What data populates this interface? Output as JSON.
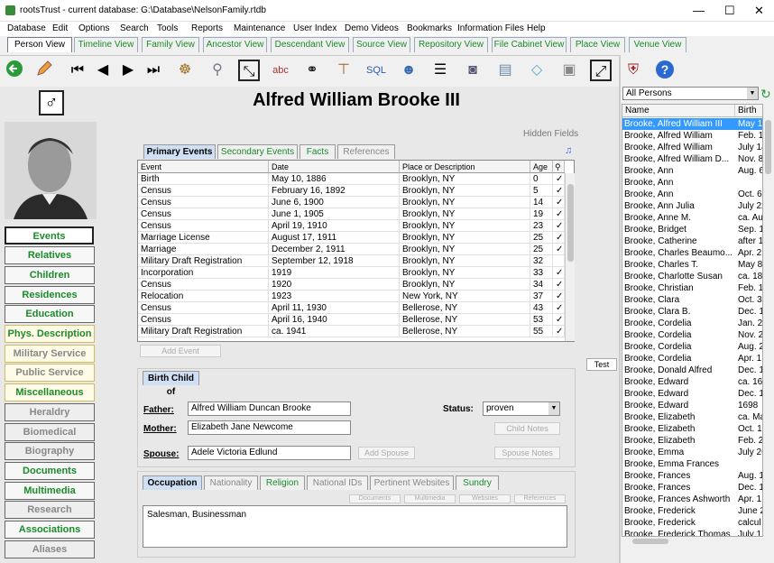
{
  "window": {
    "title": "rootsTrust - current database: G:\\Database\\NelsonFamily.rtdb"
  },
  "menu": [
    "Database",
    "Edit",
    "Options",
    "Search",
    "Tools",
    "Reports",
    "Maintenance",
    "User Index",
    "Demo Videos",
    "Bookmarks",
    "Information Files",
    "Help"
  ],
  "view_tabs": [
    "Person View",
    "Timeline View",
    "Family View",
    "Ancestor View",
    "Descendant View",
    "Source View",
    "Repository View",
    "File Cabinet View",
    "Place View",
    "Venue View"
  ],
  "person": {
    "name": "Alfred William Brooke III",
    "hidden_fields": "Hidden Fields"
  },
  "sidebar": [
    "Events",
    "Relatives",
    "Children",
    "Residences",
    "Education",
    "Phys. Description",
    "Military Service",
    "Public Service",
    "Miscellaneous",
    "Heraldry",
    "Biomedical",
    "Biography",
    "Documents",
    "Multimedia",
    "Research",
    "Associations",
    "Aliases"
  ],
  "event_tabs": [
    "Primary Events",
    "Secondary Events",
    "Facts",
    "References"
  ],
  "event_headers": [
    "Event",
    "Date",
    "Place or Description",
    "Age"
  ],
  "events": [
    {
      "event": "Birth",
      "date": "May 10, 1886",
      "place": "Brooklyn, NY",
      "age": "0",
      "chk": "✓"
    },
    {
      "event": "Census",
      "date": "February 16, 1892",
      "place": "Brooklyn, NY",
      "age": "5",
      "chk": "✓"
    },
    {
      "event": "Census",
      "date": "June 6, 1900",
      "place": "Brooklyn, NY",
      "age": "14",
      "chk": "✓"
    },
    {
      "event": "Census",
      "date": "June 1, 1905",
      "place": "Brooklyn, NY",
      "age": "19",
      "chk": "✓"
    },
    {
      "event": "Census",
      "date": "April 19, 1910",
      "place": "Brooklyn, NY",
      "age": "23",
      "chk": "✓"
    },
    {
      "event": "Marriage License",
      "date": "August 17, 1911",
      "place": "Brooklyn, NY",
      "age": "25",
      "chk": "✓"
    },
    {
      "event": "Marriage",
      "date": "December 2, 1911",
      "place": "Brooklyn, NY",
      "age": "25",
      "chk": "✓"
    },
    {
      "event": "Military Draft Registration",
      "date": "September 12, 1918",
      "place": "Brooklyn, NY",
      "age": "32",
      "chk": ""
    },
    {
      "event": "Incorporation",
      "date": "1919",
      "place": "Brooklyn, NY",
      "age": "33",
      "chk": "✓"
    },
    {
      "event": "Census",
      "date": "1920",
      "place": "Brooklyn, NY",
      "age": "34",
      "chk": "✓"
    },
    {
      "event": "Relocation",
      "date": "1923",
      "place": "New York, NY",
      "age": "37",
      "chk": "✓"
    },
    {
      "event": "Census",
      "date": "April 11, 1930",
      "place": "Bellerose, NY",
      "age": "43",
      "chk": "✓"
    },
    {
      "event": "Census",
      "date": "April 16, 1940",
      "place": "Bellerose, NY",
      "age": "53",
      "chk": "✓"
    },
    {
      "event": "Military Draft Registration",
      "date": "ca. 1941",
      "place": "Bellerose, NY",
      "age": "55",
      "chk": "✓"
    }
  ],
  "buttons": {
    "add_event": "Add Event",
    "test": "Test",
    "child_notes": "Child Notes",
    "add_spouse": "Add Spouse",
    "spouse_notes": "Spouse Notes"
  },
  "birth": {
    "tab": "Birth Child of",
    "father_label": "Father:",
    "father": "Alfred William Duncan Brooke",
    "mother_label": "Mother:",
    "mother": "Elizabeth Jane Newcome",
    "spouse_label": "Spouse:",
    "spouse": "Adele Victoria Edlund",
    "status_label": "Status:",
    "status": "proven"
  },
  "lower_tabs": [
    "Occupation",
    "Nationality",
    "Religion",
    "National IDs",
    "Pertinent Websites",
    "Sundry"
  ],
  "lower_sub": [
    "Documents",
    "Multimedia",
    "Websites",
    "References"
  ],
  "occupation": "Salesman, Businessman",
  "right": {
    "filter": "All Persons",
    "col_name": "Name",
    "col_birth": "Birth D",
    "rows": [
      [
        "Brooke, Alfred William III",
        "May 1"
      ],
      [
        "Brooke, Alfred William",
        "Feb. 1"
      ],
      [
        "Brooke, Alfred William",
        "July 14"
      ],
      [
        "Brooke, Alfred William D...",
        "Nov. 8"
      ],
      [
        "Brooke, Ann",
        "Aug. 6"
      ],
      [
        "Brooke, Ann",
        ""
      ],
      [
        "Brooke, Ann",
        "Oct. 6,"
      ],
      [
        "Brooke, Ann Julia",
        "July 22"
      ],
      [
        "Brooke, Anne M.",
        "ca. Au"
      ],
      [
        "Brooke, Bridget",
        "Sep. 1"
      ],
      [
        "Brooke, Catherine",
        "after 1"
      ],
      [
        "Brooke, Charles Beaumo...",
        "Apr. 2"
      ],
      [
        "Brooke, Charles T.",
        "May 8"
      ],
      [
        "Brooke, Charlotte Susan",
        "ca. 18"
      ],
      [
        "Brooke, Christian",
        "Feb. 1"
      ],
      [
        "Brooke, Clara",
        "Oct. 3"
      ],
      [
        "Brooke, Clara B.",
        "Dec. 1"
      ],
      [
        "Brooke, Cordelia",
        "Jan. 2"
      ],
      [
        "Brooke, Cordelia",
        "Nov. 2"
      ],
      [
        "Brooke, Cordelia",
        "Aug. 2"
      ],
      [
        "Brooke, Cordelia",
        "Apr. 1"
      ],
      [
        "Brooke, Donald Alfred",
        "Dec. 1"
      ],
      [
        "Brooke, Edward",
        "ca. 16"
      ],
      [
        "Brooke, Edward",
        "Dec. 1"
      ],
      [
        "Brooke, Edward",
        "1698"
      ],
      [
        "Brooke, Elizabeth",
        "ca. Ma"
      ],
      [
        "Brooke, Elizabeth",
        "Oct. 1"
      ],
      [
        "Brooke, Elizabeth",
        "Feb. 2"
      ],
      [
        "Brooke, Emma",
        "July 26"
      ],
      [
        "Brooke, Emma Frances",
        ""
      ],
      [
        "Brooke, Frances",
        "Aug. 1"
      ],
      [
        "Brooke, Frances",
        "Dec. 1"
      ],
      [
        "Brooke, Frances Ashworth",
        "Apr. 1"
      ],
      [
        "Brooke, Frederick",
        "June 2"
      ],
      [
        "Brooke, Frederick",
        "calcul"
      ],
      [
        "Brooke, Frederick Thomas",
        "July 1"
      ]
    ]
  }
}
